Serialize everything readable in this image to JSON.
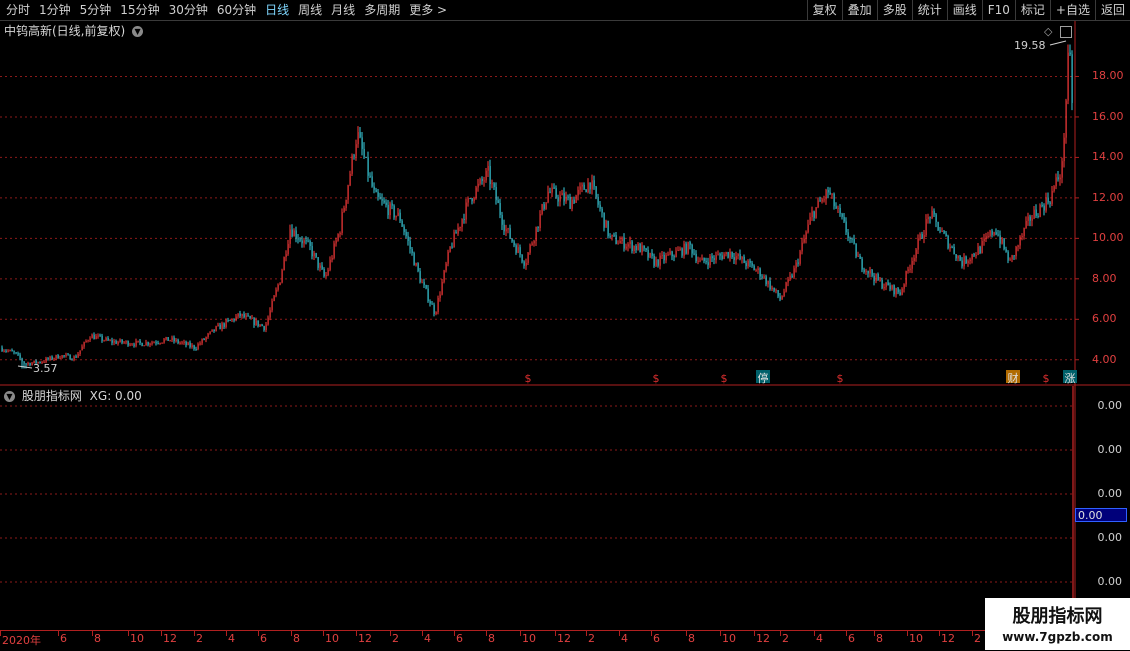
{
  "toolbar": {
    "periods": [
      "分时",
      "1分钟",
      "5分钟",
      "15分钟",
      "30分钟",
      "60分钟",
      "日线",
      "周线",
      "月线",
      "多周期",
      "更多 >"
    ],
    "active_period": "日线",
    "tools": [
      "复权",
      "叠加",
      "多股",
      "统计",
      "画线",
      "F10",
      "标记",
      "+自选",
      "返回"
    ]
  },
  "main_chart": {
    "title": "中钨高新(日线,前复权)",
    "high_label": "19.58",
    "low_label": "3.57",
    "price_labels": [
      "18.00",
      "16.00",
      "14.00",
      "12.00",
      "10.00",
      "8.00",
      "6.00",
      "4.00"
    ],
    "markers": [
      {
        "text": "$"
      },
      {
        "text": "$"
      },
      {
        "text": "$"
      },
      {
        "text": "停"
      },
      {
        "text": "$"
      },
      {
        "text": "财"
      },
      {
        "text": "$"
      },
      {
        "text": "涨"
      }
    ]
  },
  "indicator": {
    "title": "股朋指标网",
    "value_text": "XG: 0.00",
    "axis_labels": [
      "0.00",
      "0.00",
      "0.00",
      "0.00",
      "0.00"
    ],
    "current_value": "0.00"
  },
  "xaxis": {
    "labels": [
      "2020年",
      "6",
      "8",
      "10",
      "12",
      "2",
      "4",
      "6",
      "8",
      "10",
      "12",
      "2",
      "4",
      "6",
      "8",
      "10",
      "12",
      "2",
      "4",
      "6",
      "8",
      "10",
      "12",
      "2",
      "4",
      "6",
      "8",
      "10",
      "12",
      "2"
    ]
  },
  "watermark": {
    "line1": "股朋指标网",
    "line2": "www.7gpzb.com"
  },
  "colors": {
    "up": "#ff3b3b",
    "down": "#3ad0e0",
    "grid": "#8b1a1a",
    "axis": "#b02020"
  },
  "chart_data": {
    "type": "candlestick",
    "title": "中钨高新(日线,前复权)",
    "ylim": [
      3.0,
      20.0
    ],
    "high": 19.58,
    "low": 3.57,
    "x_start": "2020",
    "anchors": [
      [
        0,
        4.6
      ],
      [
        15,
        4.3
      ],
      [
        25,
        3.8
      ],
      [
        40,
        3.9
      ],
      [
        60,
        4.2
      ],
      [
        75,
        4.1
      ],
      [
        90,
        5.2
      ],
      [
        110,
        4.9
      ],
      [
        140,
        4.8
      ],
      [
        170,
        5.0
      ],
      [
        195,
        4.6
      ],
      [
        215,
        5.5
      ],
      [
        240,
        6.2
      ],
      [
        265,
        5.6
      ],
      [
        280,
        8.0
      ],
      [
        290,
        10.5
      ],
      [
        310,
        9.5
      ],
      [
        325,
        8.0
      ],
      [
        340,
        10.5
      ],
      [
        357,
        15.2
      ],
      [
        375,
        12.0
      ],
      [
        400,
        11.0
      ],
      [
        420,
        8.0
      ],
      [
        435,
        6.3
      ],
      [
        450,
        9.5
      ],
      [
        470,
        12.0
      ],
      [
        488,
        13.2
      ],
      [
        505,
        10.5
      ],
      [
        525,
        8.8
      ],
      [
        548,
        12.3
      ],
      [
        570,
        11.8
      ],
      [
        590,
        12.8
      ],
      [
        610,
        10.0
      ],
      [
        640,
        9.5
      ],
      [
        655,
        8.8
      ],
      [
        690,
        9.6
      ],
      [
        700,
        8.8
      ],
      [
        730,
        9.3
      ],
      [
        760,
        8.3
      ],
      [
        780,
        7.0
      ],
      [
        795,
        8.5
      ],
      [
        812,
        11.2
      ],
      [
        828,
        12.3
      ],
      [
        845,
        10.5
      ],
      [
        860,
        8.8
      ],
      [
        880,
        7.8
      ],
      [
        900,
        7.3
      ],
      [
        912,
        9.0
      ],
      [
        930,
        11.2
      ],
      [
        945,
        10.0
      ],
      [
        962,
        8.8
      ],
      [
        980,
        9.5
      ],
      [
        995,
        10.5
      ],
      [
        1010,
        8.8
      ],
      [
        1030,
        11.0
      ],
      [
        1050,
        12.0
      ],
      [
        1062,
        13.5
      ],
      [
        1069,
        19.5
      ],
      [
        1073,
        16.0
      ]
    ]
  }
}
